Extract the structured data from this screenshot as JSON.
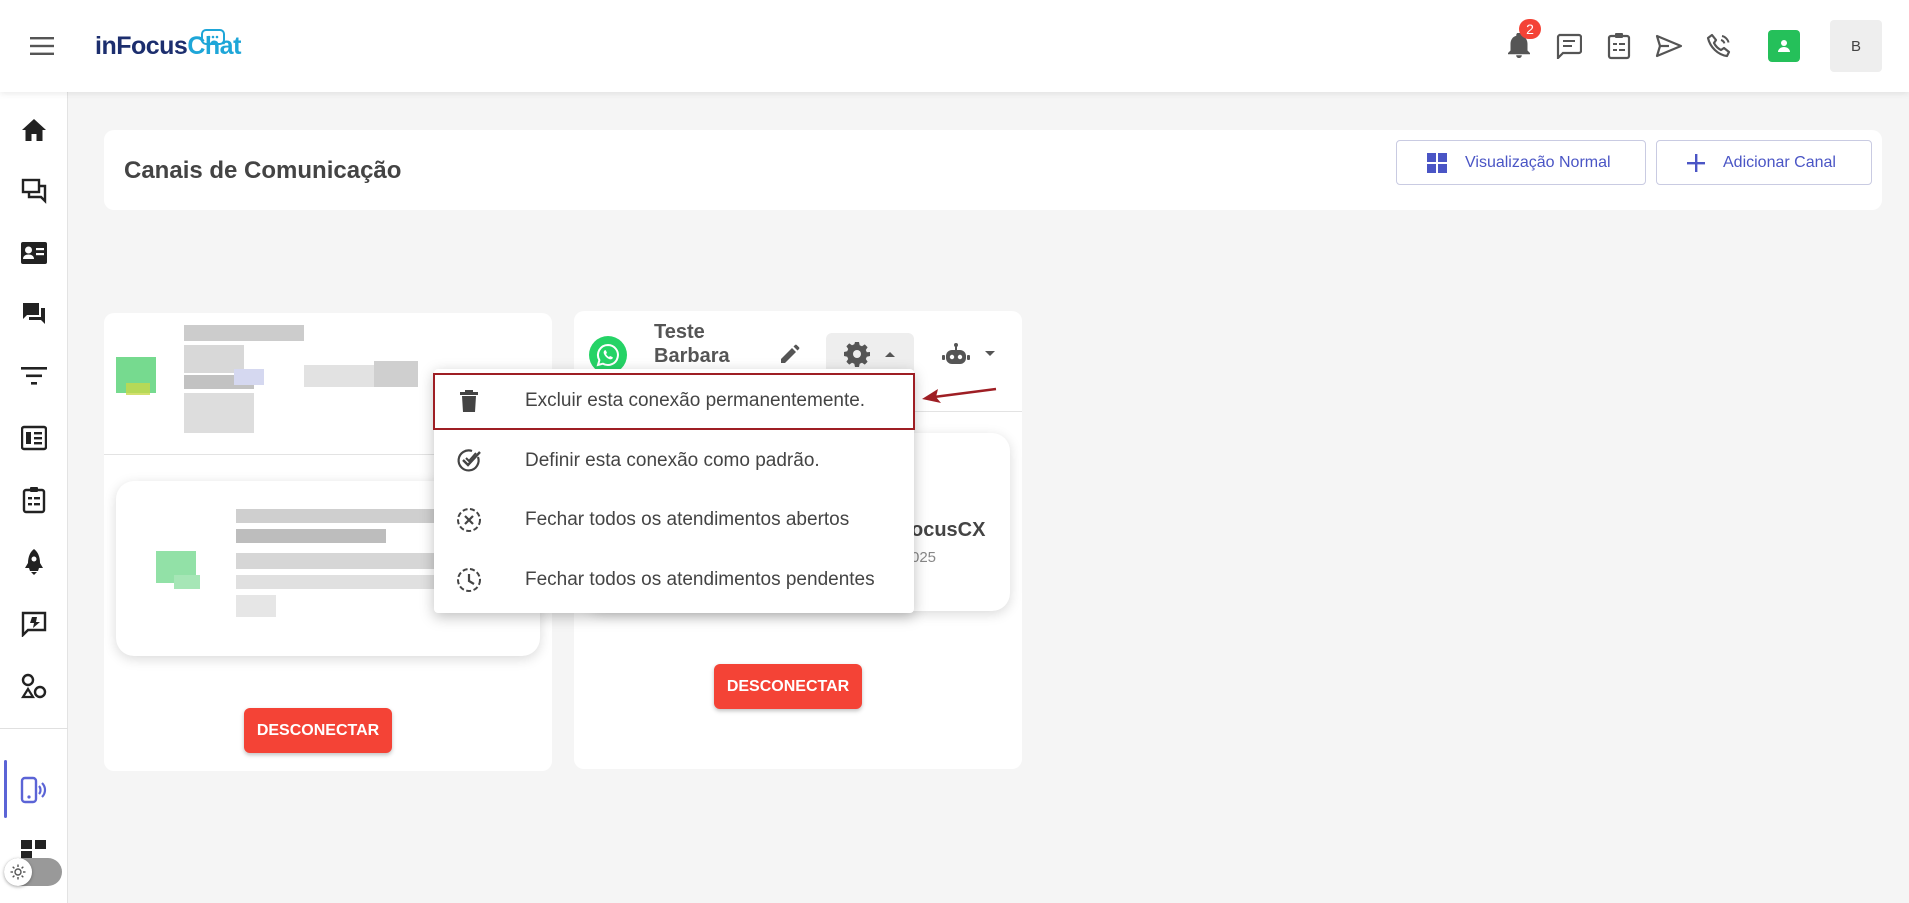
{
  "app": {
    "logo_part1": "inFocus",
    "logo_part2": "Chat"
  },
  "header": {
    "notification_count": "2",
    "avatar_initial": "B"
  },
  "page": {
    "title": "Canais de Comunicação",
    "view_button": "Visualização Normal",
    "add_button": "Adicionar Canal"
  },
  "cards": [
    {
      "disconnect_label": "DESCONECTAR"
    },
    {
      "name_line1": "Teste",
      "name_line2": "Barbara",
      "partial_text": "ocusCX",
      "partial_date": "025",
      "disconnect_label": "DESCONECTAR"
    }
  ],
  "menu": {
    "items": [
      {
        "label": "Excluir esta conexão permanentemente.",
        "icon": "trash-icon"
      },
      {
        "label": "Definir esta conexão como padrão.",
        "icon": "check-circle-icon"
      },
      {
        "label": "Fechar todos os atendimentos abertos",
        "icon": "close-circle-icon"
      },
      {
        "label": "Fechar todos os atendimentos pendentes",
        "icon": "clock-history-icon"
      }
    ]
  },
  "colors": {
    "accent": "#4a55c5",
    "danger": "#f44336",
    "whatsapp": "#25d366",
    "highlight": "#9e1e24"
  }
}
